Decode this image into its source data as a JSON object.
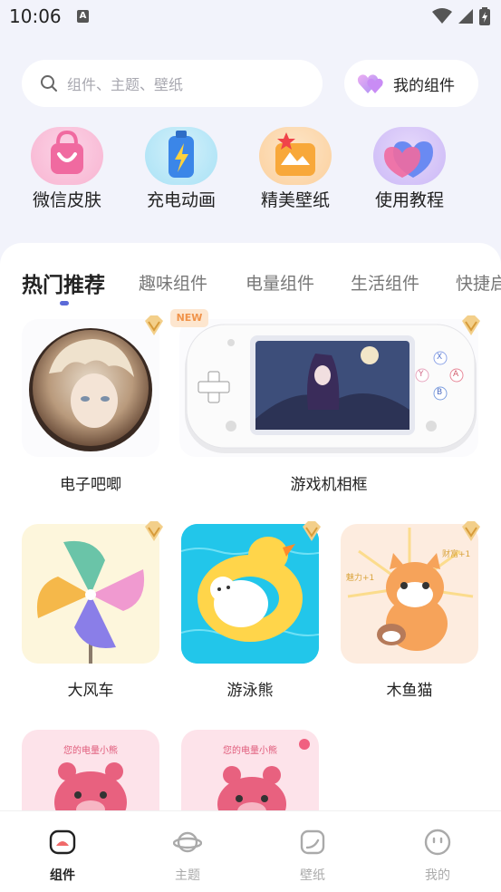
{
  "status": {
    "time": "10:06"
  },
  "search": {
    "placeholder": "组件、主题、壁纸"
  },
  "my_widgets": {
    "label": "我的组件"
  },
  "quick": [
    {
      "label": "微信皮肤",
      "icon": "bag-icon"
    },
    {
      "label": "充电动画",
      "icon": "battery-icon"
    },
    {
      "label": "精美壁纸",
      "icon": "folder-star-icon"
    },
    {
      "label": "使用教程",
      "icon": "heart-icon"
    }
  ],
  "tabs": [
    "热门推荐",
    "趣味组件",
    "电量组件",
    "生活组件",
    "快捷启"
  ],
  "widgets": [
    {
      "label": "电子吧唧"
    },
    {
      "label": "游戏机相框",
      "badge": "NEW"
    },
    {
      "label": "大风车"
    },
    {
      "label": "游泳熊"
    },
    {
      "label": "木鱼猫"
    },
    {
      "caption": "您的电量小熊"
    },
    {
      "caption": "您的电量小熊"
    }
  ],
  "game_buttons": [
    "X",
    "Y",
    "A",
    "B"
  ],
  "cat_text": {
    "left": "魅力+1",
    "right": "财富+1"
  },
  "nav": [
    {
      "label": "组件",
      "active": true
    },
    {
      "label": "主题"
    },
    {
      "label": "壁纸"
    },
    {
      "label": "我的"
    }
  ],
  "colors": {
    "accent": "#5b6ad8",
    "background": "#f2f3fb"
  }
}
